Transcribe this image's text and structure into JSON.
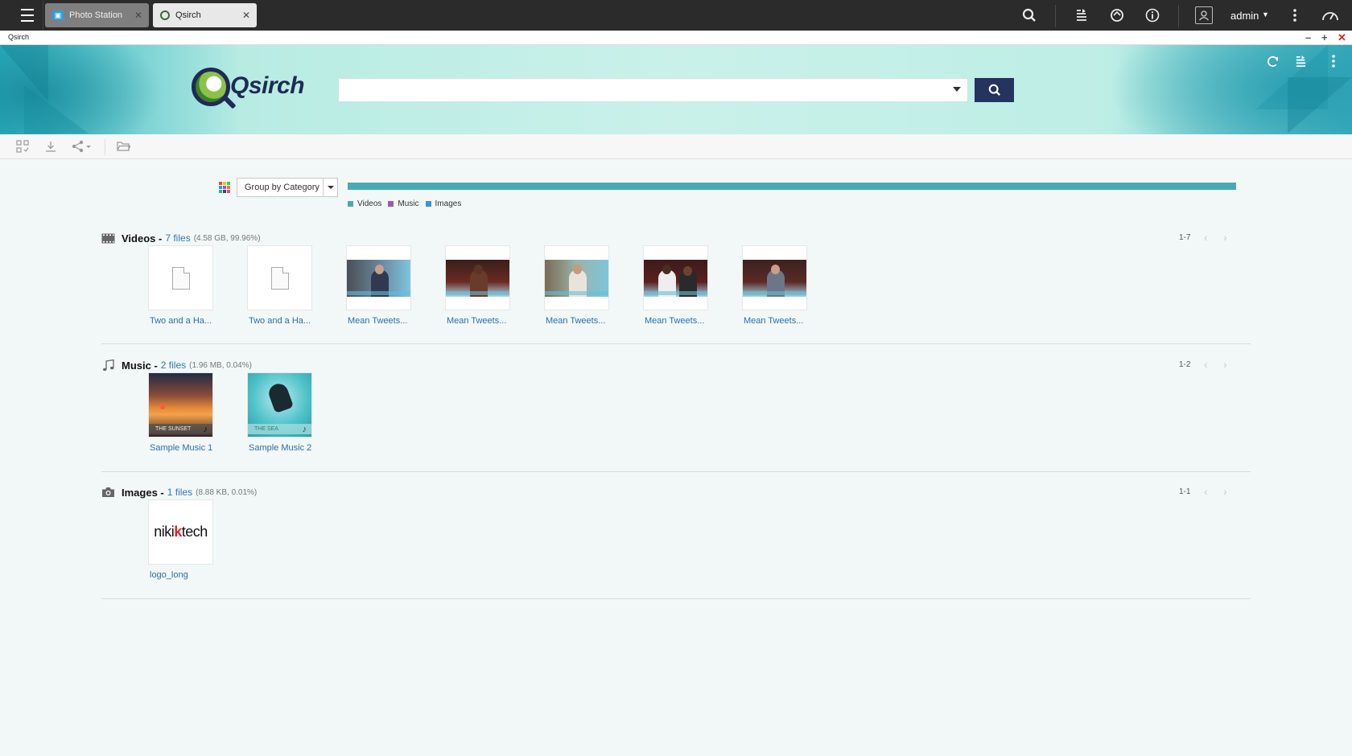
{
  "taskbar": {
    "tabs": [
      {
        "label": "Photo Station",
        "icon": "photo-station-icon"
      },
      {
        "label": "Qsirch",
        "icon": "qsirch-icon"
      }
    ],
    "user": "admin"
  },
  "window": {
    "title": "Qsirch",
    "controls": {
      "minimize": "–",
      "maximize": "+",
      "close": "✕"
    }
  },
  "header": {
    "logo_text": "Qsirch",
    "search": {
      "value": "",
      "placeholder": ""
    }
  },
  "category_bar": {
    "group_by_label": "Group by Category",
    "legend": [
      {
        "label": "Videos",
        "color": "#4aaab4"
      },
      {
        "label": "Music",
        "color": "#9b59b6"
      },
      {
        "label": "Images",
        "color": "#3498db"
      }
    ]
  },
  "sections": [
    {
      "title": "Videos -",
      "count": "7 files",
      "meta": "(4.58 GB, 99.96%)",
      "range": "1-7",
      "items": [
        {
          "label": "Two and a Ha..."
        },
        {
          "label": "Two and a Ha..."
        },
        {
          "label": "Mean Tweets..."
        },
        {
          "label": "Mean Tweets..."
        },
        {
          "label": "Mean Tweets..."
        },
        {
          "label": "Mean Tweets..."
        },
        {
          "label": "Mean Tweets..."
        }
      ]
    },
    {
      "title": "Music -",
      "count": "2 files",
      "meta": "(1.96 MB, 0.04%)",
      "range": "1-2",
      "items": [
        {
          "label": "Sample Music 1",
          "strip": "THE SUNSET"
        },
        {
          "label": "Sample Music 2",
          "strip": "THE SEA"
        }
      ]
    },
    {
      "title": "Images -",
      "count": "1 files",
      "meta": "(8.88 KB, 0.01%)",
      "range": "1-1",
      "items": [
        {
          "label": "logo_long",
          "logo_a": "niki",
          "logo_b": "k",
          "logo_c": "tech"
        }
      ]
    }
  ],
  "colors": {
    "accent": "#25335e",
    "link": "#2a6fa8",
    "bar": "#4aaab4",
    "close": "#d9262c"
  }
}
